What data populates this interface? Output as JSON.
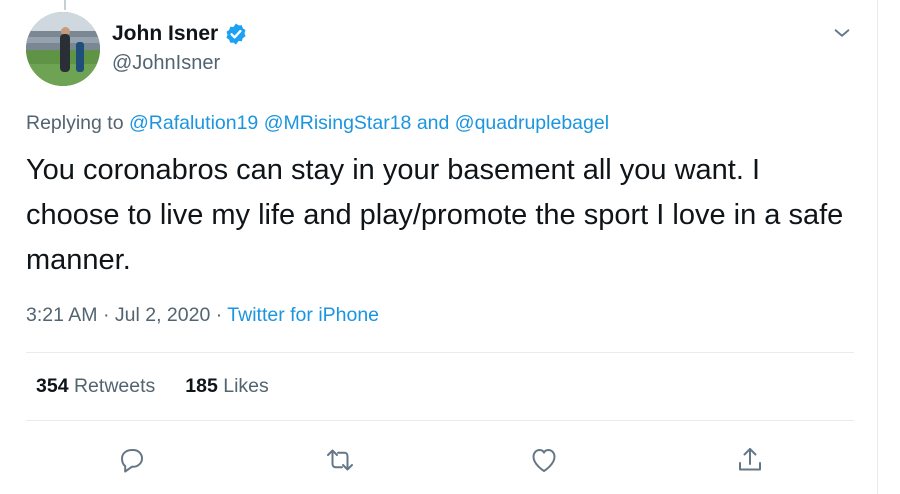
{
  "author": {
    "name": "John Isner",
    "handle": "@JohnIsner",
    "verified": true
  },
  "replying": {
    "prefix": "Replying to",
    "mention1": "@Rafalution19",
    "mention2": "@MRisingStar18",
    "conjunction": "and",
    "mention3": "@quadruplebagel"
  },
  "tweet": {
    "text": "You coronabros can stay in your basement all you want. I choose to live my life and play/promote the sport I love in a safe manner.",
    "time": "3:21 AM",
    "date": "Jul 2, 2020",
    "source": "Twitter for iPhone"
  },
  "stats": {
    "retweets_count": "354",
    "retweets_label": "Retweets",
    "likes_count": "185",
    "likes_label": "Likes"
  },
  "colors": {
    "link": "#1b95e0",
    "verified_badge": "#1da1f2",
    "secondary_text": "#536471",
    "icon": "#657786"
  },
  "icons": [
    "verified-badge-icon",
    "chevron-down-icon",
    "reply-icon",
    "retweet-icon",
    "like-icon",
    "share-icon"
  ]
}
